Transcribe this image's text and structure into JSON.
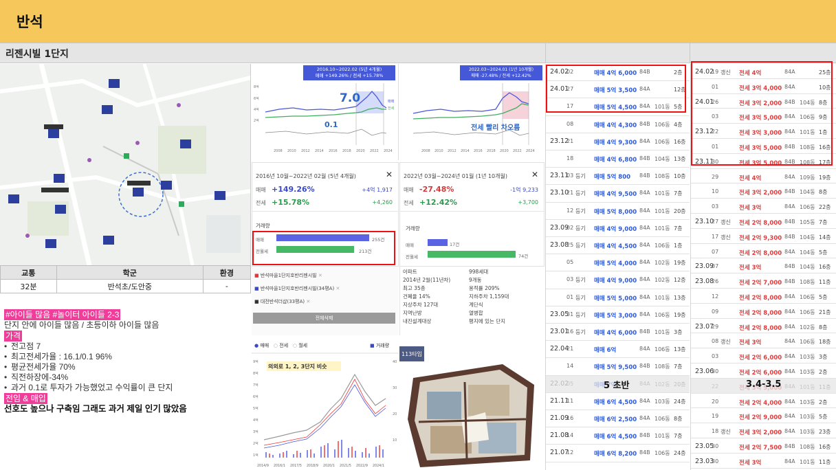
{
  "title": "반석",
  "complex_name": "리젠시빌 1단지",
  "facts": {
    "headers": [
      "교통",
      "학군",
      "환경"
    ],
    "values": [
      "32분",
      "반석초/도안중",
      "-"
    ]
  },
  "notes": {
    "tag1": "#아이들 많음 #놀이터 아이들 2-3",
    "line1": "단지 안에 아이들 많음 / 초등이하 아이들 많음",
    "price_tag": "가격",
    "bullets": [
      "전고점 7",
      "최고전세가율 : 16.1/0.1 96%",
      "평균전세가율 70%",
      "직전하장에-34%",
      "과거 0.1로 투자가 가능했었고 수익률이 큰 단지"
    ],
    "tag2": "전임 & 매입",
    "conclusion": "선호도 높으나 구축임 그래도 과거 제일 인기 많았음"
  },
  "chart1": {
    "period": "2016.10~2022.02 (5년 4개월)",
    "change": "매매 +149.26% / 전세 +15.78%",
    "overlay_high": "7.0",
    "overlay_low": "0.1",
    "leg_sale": "매매",
    "leg_rent": "전세",
    "years": [
      "2008",
      "2010",
      "2012",
      "2014",
      "2016",
      "2018",
      "2020",
      "2022",
      "2024"
    ],
    "y_ticks": [
      "8억",
      "6억",
      "4억",
      "2억"
    ]
  },
  "chart2": {
    "period": "2022.03~2024.01 (1년 10개월)",
    "change": "매매 -27.48% / 전세 +12.42%",
    "overlay": "전세 빨리 차오름",
    "years": [
      "2008",
      "2010",
      "2012",
      "2014",
      "2016",
      "2018",
      "2020",
      "2022",
      "2024"
    ]
  },
  "stat1": {
    "period": "2016년 10월~2022년 02월 (5년 4개월)",
    "sale_label": "매매",
    "sale_pct": "+149.26%",
    "sale_amt": "+4억 1,917",
    "rent_label": "전세",
    "rent_pct": "+15.78%",
    "rent_amt": "+4,260",
    "volume_label": "거래량",
    "vol_sale_label": "매매",
    "vol_sale": "255건",
    "vol_rent_label": "전월세",
    "vol_rent": "213건"
  },
  "stat2": {
    "period": "2022년 03월~2024년 01월 (1년 10개월)",
    "sale_label": "매매",
    "sale_pct": "-27.48%",
    "sale_amt": "-1억 9,233",
    "rent_label": "전세",
    "rent_pct": "+12.42%",
    "rent_amt": "+3,700",
    "volume_label": "거래량",
    "vol_sale_label": "매매",
    "vol_sale": "17건",
    "vol_rent_label": "전월세",
    "vol_rent": "74건"
  },
  "compare": {
    "items": [
      "반석마을1단지호반리젠시빌",
      "반석마을1단지호반리젠시빌(34평A)",
      "대전반석더샵(33평A)"
    ],
    "button": "전체삭제"
  },
  "info": {
    "left": [
      "아파트",
      "2014년 2월(11년차)",
      "최고 35층",
      "건폐율 14%",
      "지상주차 127대",
      "지역난방",
      "내진설계대상"
    ],
    "right": [
      "998세대",
      "9개동",
      "용적률 209%",
      "지하주차 1,159대",
      "계단식",
      "열병합",
      "평지에 있는 단지"
    ]
  },
  "bottom_chart": {
    "tabs": [
      "매매",
      "전세",
      "월세"
    ],
    "vol": "거래량",
    "overlay": "의외로 1, 2, 3단지 비슷",
    "x": [
      "2014/9",
      "2016/1",
      "2017/5",
      "2018/9",
      "2020/1",
      "2021/5",
      "2022/9",
      "2024/1"
    ],
    "y_left": [
      "9억",
      "8억",
      "7억",
      "6억",
      "5억",
      "4억",
      "3억",
      "2억",
      "1억"
    ],
    "y_right": [
      "40",
      "30",
      "20",
      "10"
    ]
  },
  "floorplan": {
    "label": "113타입"
  },
  "sales": {
    "overlay": "5 초반",
    "rows": [
      [
        "24.02",
        "02",
        "",
        "매매 4억 6,000",
        "84B",
        "",
        "2층"
      ],
      [
        "24.01",
        "27",
        "",
        "매매 5억 3,500",
        "84A",
        "",
        "12층"
      ],
      [
        "",
        "17",
        "",
        "매매 5억 4,500",
        "84A",
        "101동",
        "5층"
      ],
      [
        "",
        "08",
        "",
        "매매 4억 4,300",
        "84B",
        "106동",
        "4층"
      ],
      [
        "23.12",
        "21",
        "",
        "매매 4억 9,300",
        "84A",
        "106동",
        "16층"
      ],
      [
        "",
        "18",
        "",
        "매매 4억 6,800",
        "84B",
        "104동",
        "13층"
      ],
      [
        "23.11",
        "03",
        "등기",
        "매매 5억 800",
        "84B",
        "108동",
        "10층"
      ],
      [
        "23.10",
        "21",
        "등기",
        "매매 4억 9,500",
        "84A",
        "101동",
        "7층"
      ],
      [
        "",
        "12",
        "등기",
        "매매 5억 8,000",
        "84A",
        "101동",
        "20층"
      ],
      [
        "23.09",
        "02",
        "등기",
        "매매 4억 9,000",
        "84A",
        "101동",
        "7층"
      ],
      [
        "23.08",
        "25",
        "등기",
        "매매 4억 4,500",
        "84A",
        "106동",
        "1층"
      ],
      [
        "",
        "05",
        "",
        "매매 5억 4,000",
        "84A",
        "102동",
        "19층"
      ],
      [
        "",
        "03",
        "등기",
        "매매 4억 9,000",
        "84A",
        "102동",
        "12층"
      ],
      [
        "",
        "01",
        "등기",
        "매매 5억 5,000",
        "84A",
        "101동",
        "13층"
      ],
      [
        "23.05",
        "31",
        "등기",
        "매매 5억 3,000",
        "84A",
        "106동",
        "19층"
      ],
      [
        "23.01",
        "16",
        "등기",
        "매매 4억 6,000",
        "84B",
        "101동",
        "3층"
      ],
      [
        "22.04",
        "21",
        "",
        "매매 6억",
        "84A",
        "106동",
        "13층"
      ],
      [
        "",
        "14",
        "",
        "매매 5억 9,500",
        "84B",
        "108동",
        "7층"
      ],
      [
        "22.02",
        "05",
        "",
        "매매 7억",
        "84A",
        "102동",
        "20층"
      ],
      [
        "21.11",
        "11",
        "",
        "매매 6억 4,500",
        "84A",
        "103동",
        "24층"
      ],
      [
        "21.09",
        "16",
        "",
        "매매 6억 2,500",
        "84A",
        "106동",
        "8층"
      ],
      [
        "21.08",
        "14",
        "",
        "매매 6억 4,500",
        "84B",
        "101동",
        "7층"
      ],
      [
        "21.07",
        "12",
        "",
        "매매 6억 8,200",
        "84B",
        "106동",
        "24층"
      ]
    ]
  },
  "rents": {
    "overlay": "3.4-3.5",
    "rows": [
      [
        "24.02",
        "19",
        "갱신",
        "전세 4억",
        "84A",
        "",
        "25층"
      ],
      [
        "",
        "01",
        "",
        "전세 3억 4,000",
        "84A",
        "",
        "10층"
      ],
      [
        "24.01",
        "26",
        "",
        "전세 3억 2,000",
        "84B",
        "104동",
        "8층"
      ],
      [
        "",
        "03",
        "",
        "전세 3억 5,000",
        "84A",
        "106동",
        "9층"
      ],
      [
        "23.12",
        "22",
        "",
        "전세 3억 3,000",
        "84A",
        "101동",
        "1층"
      ],
      [
        "",
        "01",
        "",
        "전세 3억 5,000",
        "84B",
        "108동",
        "16층"
      ],
      [
        "23.11",
        "30",
        "",
        "전세 3억 5,000",
        "84B",
        "108동",
        "17층"
      ],
      [
        "",
        "29",
        "",
        "전세 4억",
        "84A",
        "109동",
        "19층"
      ],
      [
        "",
        "10",
        "",
        "전세 3억 2,000",
        "84B",
        "104동",
        "8층"
      ],
      [
        "",
        "03",
        "",
        "전세 3억",
        "84A",
        "106동",
        "22층"
      ],
      [
        "23.10",
        "27",
        "갱신",
        "전세 2억 8,000",
        "84B",
        "105동",
        "7층"
      ],
      [
        "",
        "17",
        "갱신",
        "전세 2억 9,300",
        "84B",
        "104동",
        "14층"
      ],
      [
        "",
        "07",
        "",
        "전세 2억 8,000",
        "84A",
        "104동",
        "5층"
      ],
      [
        "23.09",
        "07",
        "",
        "전세 3억",
        "84B",
        "104동",
        "16층"
      ],
      [
        "23.08",
        "26",
        "",
        "전세 2억 7,000",
        "84B",
        "108동",
        "11층"
      ],
      [
        "",
        "12",
        "",
        "전세 2억 8,000",
        "84A",
        "106동",
        "5층"
      ],
      [
        "",
        "09",
        "",
        "전세 2억 8,000",
        "84A",
        "106동",
        "21층"
      ],
      [
        "23.07",
        "29",
        "",
        "전세 2억 8,000",
        "84A",
        "102동",
        "8층"
      ],
      [
        "",
        "08",
        "갱신",
        "전세 3억",
        "84A",
        "106동",
        "18층"
      ],
      [
        "",
        "03",
        "",
        "전세 2억 6,000",
        "84A",
        "103동",
        "3층"
      ],
      [
        "23.06",
        "30",
        "",
        "전세 2억 6,000",
        "84A",
        "103동",
        "2층"
      ],
      [
        "",
        "22",
        "",
        "전세 3억 5,000",
        "84A",
        "101동",
        "11층"
      ],
      [
        "",
        "20",
        "",
        "전세 2억 4,000",
        "84A",
        "103동",
        "2층"
      ],
      [
        "",
        "19",
        "",
        "전세 2억 9,000",
        "84A",
        "103동",
        "5층"
      ],
      [
        "",
        "18",
        "갱신",
        "전세 3억 2,000",
        "84A",
        "103동",
        "23층"
      ],
      [
        "23.05",
        "30",
        "",
        "전세 2억 7,500",
        "84B",
        "108동",
        "16층"
      ],
      [
        "23.03",
        "30",
        "",
        "전세 3억",
        "84A",
        "101동",
        "11층"
      ]
    ]
  },
  "colors": {
    "header": "#f6c85c",
    "sale": "#4a55e0",
    "rent": "#3fae5b",
    "red": "#e11111",
    "pink": "#f13d9a"
  }
}
